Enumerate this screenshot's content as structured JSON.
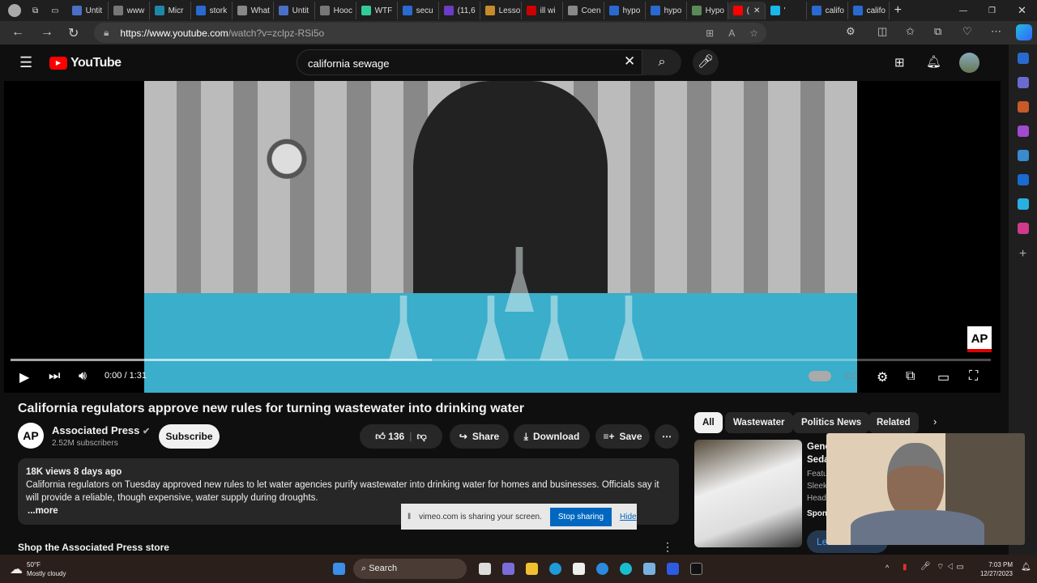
{
  "browser": {
    "tabs": [
      {
        "label": "Untit",
        "color": "#4a6fc4"
      },
      {
        "label": "www",
        "color": "#777"
      },
      {
        "label": "Micr",
        "color": "#1e88a8"
      },
      {
        "label": "stork",
        "color": "#2a6ad0"
      },
      {
        "label": "What",
        "color": "#888"
      },
      {
        "label": "Untit",
        "color": "#4a6fc4"
      },
      {
        "label": "Hooc",
        "color": "#777"
      },
      {
        "label": "WTF",
        "color": "#3c9"
      },
      {
        "label": "secu",
        "color": "#2a6ad0"
      },
      {
        "label": "(11,6",
        "color": "#6a3dc4"
      },
      {
        "label": "Lesso",
        "color": "#c68c2a"
      },
      {
        "label": "ill wi",
        "color": "#c00"
      },
      {
        "label": "Coen",
        "color": "#888"
      },
      {
        "label": "hypo",
        "color": "#2a6ad0"
      },
      {
        "label": "hypo",
        "color": "#2a6ad0"
      },
      {
        "label": "Hypo",
        "color": "#5a8a5a"
      },
      {
        "label": "(",
        "color": "#f00",
        "active": true
      },
      {
        "label": "'",
        "color": "#1ab7ea"
      },
      {
        "label": "califo",
        "color": "#2a6ad0"
      },
      {
        "label": "califo",
        "color": "#2a6ad0"
      }
    ],
    "url_host": "https://www.youtube.com",
    "url_path": "/watch?v=zclpz-RSi5o"
  },
  "youtube": {
    "logo": "YouTube",
    "search_value": "california sewage",
    "video": {
      "time": "0:00 / 1:31",
      "progress_buffered": 0.43,
      "watermark": "AP"
    },
    "title": "California regulators approve new rules for turning wastewater into drinking water",
    "channel": {
      "name": "Associated Press",
      "subscribers": "2.52M subscribers",
      "avatar": "AP"
    },
    "subscribe": "Subscribe",
    "likes": "136",
    "share": "Share",
    "download": "Download",
    "save": "Save",
    "description": {
      "meta": "18K views  8 days ago",
      "text": "California regulators on Tuesday approved new rules to let water agencies purify wastewater into drinking water for homes and businesses. Officials say it will provide a reliable, though expensive, water supply during droughts.",
      "more": "...more"
    },
    "store": "Shop the Associated Press store",
    "chips": [
      "All",
      "Wastewater",
      "Politics News",
      "Related"
    ],
    "ad": {
      "title1": "Gene",
      "title2": "Seda",
      "l1": "Featu",
      "l2": "Sleek",
      "l3": "Head",
      "sponsored": "Spon",
      "cta": "Le"
    }
  },
  "share_bar": {
    "text": "vimeo.com is sharing your screen.",
    "stop": "Stop sharing",
    "hide": "Hide"
  },
  "taskbar": {
    "temp": "50°F",
    "weather": "Mostly cloudy",
    "search": "Search",
    "time": "7:03 PM",
    "date": "12/27/2023"
  }
}
